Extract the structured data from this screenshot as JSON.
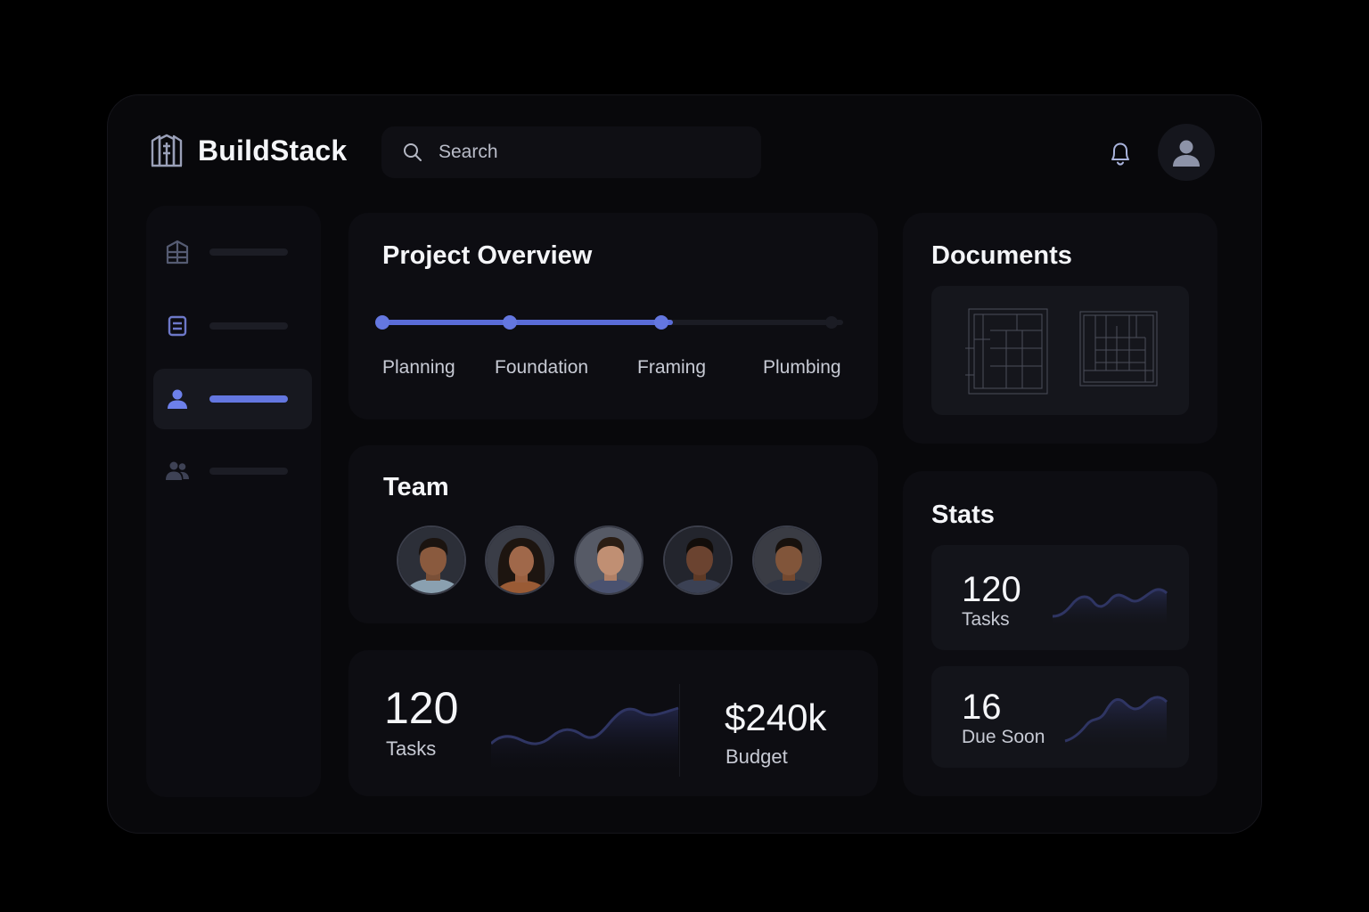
{
  "app": {
    "brand": "BuildStack"
  },
  "header": {
    "search_placeholder": "Search"
  },
  "project_overview": {
    "title": "Project Overview",
    "stages": [
      "Planning",
      "Foundation",
      "Framing",
      "Plumbing"
    ],
    "completed_stages": 3
  },
  "documents": {
    "title": "Documents"
  },
  "team": {
    "title": "Team",
    "member_count": 5
  },
  "metrics": {
    "tasks_value": "120",
    "tasks_label": "Tasks",
    "budget_value": "$240k",
    "budget_label": "Budget"
  },
  "stats": {
    "title": "Stats",
    "items": [
      {
        "value": "120",
        "label": "Tasks"
      },
      {
        "value": "16",
        "label": "Due Soon"
      }
    ]
  },
  "colors": {
    "accent": "#6477e0",
    "background": "#000000",
    "card": "#0d0d12"
  },
  "icons": [
    "building-icon",
    "search-icon",
    "bell-icon",
    "user-icon",
    "document-icon",
    "team-icon"
  ]
}
